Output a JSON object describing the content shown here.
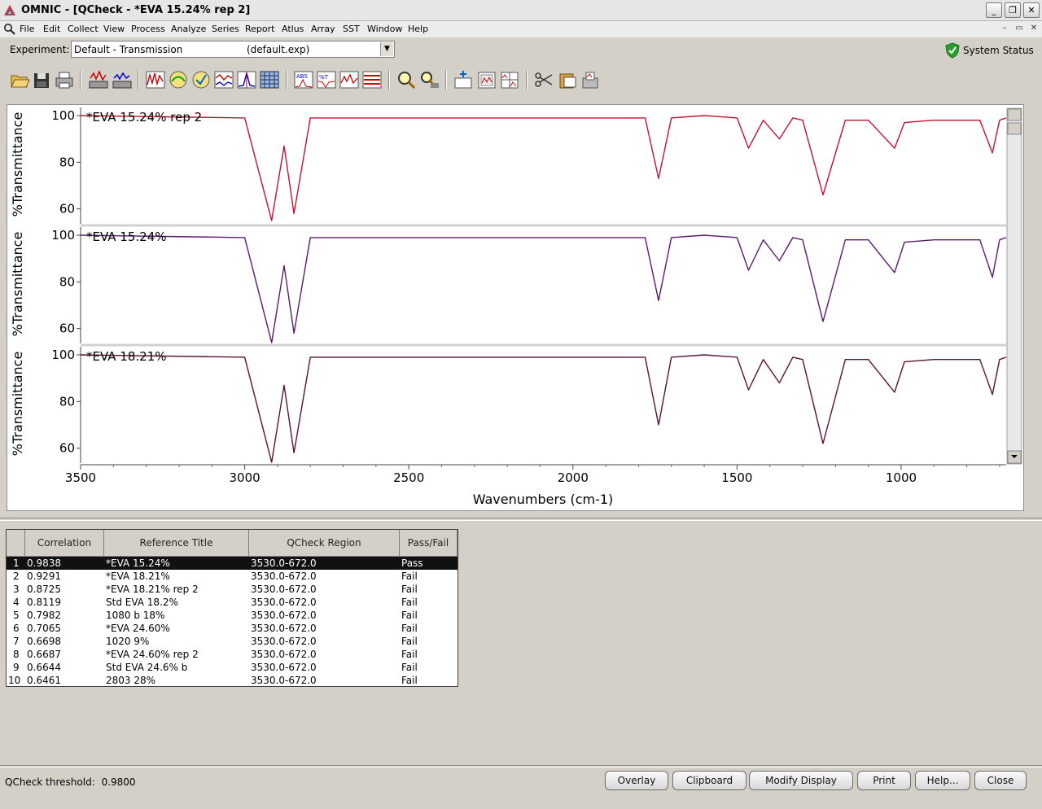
{
  "window": {
    "title": "OMNIC - [QCheck - *EVA 15.24% rep 2]",
    "buttons": [
      "_",
      "❐",
      "✕"
    ]
  },
  "menu": {
    "items": [
      "File",
      "Edit",
      "Collect",
      "View",
      "Process",
      "Analyze",
      "Series",
      "Report",
      "Atlus",
      "Array",
      "SST",
      "Window",
      "Help"
    ],
    "mdi_buttons": [
      "–",
      "▭",
      "✕"
    ]
  },
  "experiment": {
    "label": "Experiment:",
    "name": "Default - Transmission",
    "file": "(default.exp)",
    "arrow": "▼"
  },
  "system_status": {
    "label": "System Status",
    "color": "#2aa02a"
  },
  "toolbar": {
    "icons": [
      "open-icon",
      "save-icon",
      "print-icon",
      "collect-sample-icon",
      "collect-background-icon",
      "spectral-math-icon",
      "baseline-icon",
      "correct-icon",
      "smooth-icon",
      "peak-icon",
      "grid-icon",
      "absorbance-icon",
      "transmittance-icon",
      "spectra-icon",
      "stack-icon",
      "zoom-icon",
      "search-icon",
      "new-window-icon",
      "display-icon",
      "stack-display-icon",
      "cut-icon",
      "paste-icon",
      "library-icon"
    ]
  },
  "spectra": {
    "panes": [
      {
        "label": "*EVA 15.24% rep 2",
        "color": "#c8102e"
      },
      {
        "label": "*EVA 15.24%",
        "color": "#5b1a6e"
      },
      {
        "label": "*EVA 18.21%",
        "color": "#5a1238"
      }
    ],
    "y_axis_label": "%Transmittance",
    "y_ticks": [
      "100",
      "80",
      "60"
    ],
    "x_axis_label": "Wavenumbers (cm-1)",
    "x_ticks": [
      "3500",
      "3000",
      "2500",
      "2000",
      "1500",
      "1000"
    ]
  },
  "chart_data": {
    "type": "line",
    "xlabel": "Wavenumbers (cm-1)",
    "ylabel": "%Transmittance",
    "xlim": [
      3500,
      680
    ],
    "ylim": [
      55,
      100
    ],
    "series": [
      {
        "name": "*EVA 15.24% rep 2",
        "x": [
          3500,
          3000,
          2918,
          2880,
          2850,
          2800,
          2500,
          2000,
          1780,
          1739,
          1700,
          1600,
          1500,
          1465,
          1420,
          1371,
          1330,
          1300,
          1238,
          1170,
          1100,
          1020,
          990,
          900,
          760,
          722,
          700,
          680
        ],
        "y": [
          100,
          99,
          55,
          87,
          58,
          99,
          99,
          99,
          99,
          73,
          99,
          100,
          99,
          86,
          98,
          90,
          99,
          98,
          66,
          98,
          98,
          86,
          97,
          98,
          98,
          84,
          98,
          99
        ]
      },
      {
        "name": "*EVA 15.24%",
        "x": [
          3500,
          3000,
          2918,
          2880,
          2850,
          2800,
          2500,
          2000,
          1780,
          1739,
          1700,
          1600,
          1500,
          1465,
          1420,
          1371,
          1330,
          1300,
          1238,
          1170,
          1100,
          1020,
          990,
          900,
          760,
          722,
          700,
          680
        ],
        "y": [
          100,
          99,
          54,
          87,
          58,
          99,
          99,
          99,
          99,
          72,
          99,
          100,
          99,
          85,
          98,
          89,
          99,
          98,
          63,
          98,
          98,
          84,
          97,
          98,
          98,
          82,
          98,
          99
        ]
      },
      {
        "name": "*EVA 18.21%",
        "x": [
          3500,
          3000,
          2918,
          2880,
          2850,
          2800,
          2500,
          2000,
          1780,
          1739,
          1700,
          1600,
          1500,
          1465,
          1420,
          1371,
          1330,
          1300,
          1238,
          1170,
          1100,
          1020,
          990,
          900,
          760,
          722,
          700,
          680
        ],
        "y": [
          100,
          99,
          54,
          87,
          58,
          99,
          99,
          99,
          99,
          70,
          99,
          100,
          99,
          85,
          98,
          88,
          99,
          98,
          62,
          98,
          98,
          84,
          97,
          98,
          98,
          83,
          98,
          99
        ]
      }
    ]
  },
  "results": {
    "headers": [
      "",
      "Correlation",
      "Reference Title",
      "QCheck Region",
      "Pass/Fail"
    ],
    "rows": [
      {
        "index": "1",
        "correlation": "0.9838",
        "title": "*EVA 15.24%",
        "region": "3530.0-672.0",
        "result": "Pass"
      },
      {
        "index": "2",
        "correlation": "0.9291",
        "title": "*EVA 18.21%",
        "region": "3530.0-672.0",
        "result": "Fail"
      },
      {
        "index": "3",
        "correlation": "0.8725",
        "title": "*EVA 18.21% rep 2",
        "region": "3530.0-672.0",
        "result": "Fail"
      },
      {
        "index": "4",
        "correlation": "0.8119",
        "title": "Std EVA 18.2%",
        "region": "3530.0-672.0",
        "result": "Fail"
      },
      {
        "index": "5",
        "correlation": "0.7982",
        "title": "1080 b 18%",
        "region": "3530.0-672.0",
        "result": "Fail"
      },
      {
        "index": "6",
        "correlation": "0.7065",
        "title": "*EVA 24.60%",
        "region": "3530.0-672.0",
        "result": "Fail"
      },
      {
        "index": "7",
        "correlation": "0.6698",
        "title": "1020 9%",
        "region": "3530.0-672.0",
        "result": "Fail"
      },
      {
        "index": "8",
        "correlation": "0.6687",
        "title": "*EVA 24.60% rep 2",
        "region": "3530.0-672.0",
        "result": "Fail"
      },
      {
        "index": "9",
        "correlation": "0.6644",
        "title": "Std EVA 24.6% b",
        "region": "3530.0-672.0",
        "result": "Fail"
      },
      {
        "index": "10",
        "correlation": "0.6461",
        "title": "2803 28%",
        "region": "3530.0-672.0",
        "result": "Fail"
      }
    ]
  },
  "footer": {
    "threshold_label": "QCheck threshold:",
    "threshold_value": "0.9800",
    "buttons": [
      "Overlay",
      "Clipboard",
      "Modify Display",
      "Print",
      "Help...",
      "Close"
    ]
  }
}
